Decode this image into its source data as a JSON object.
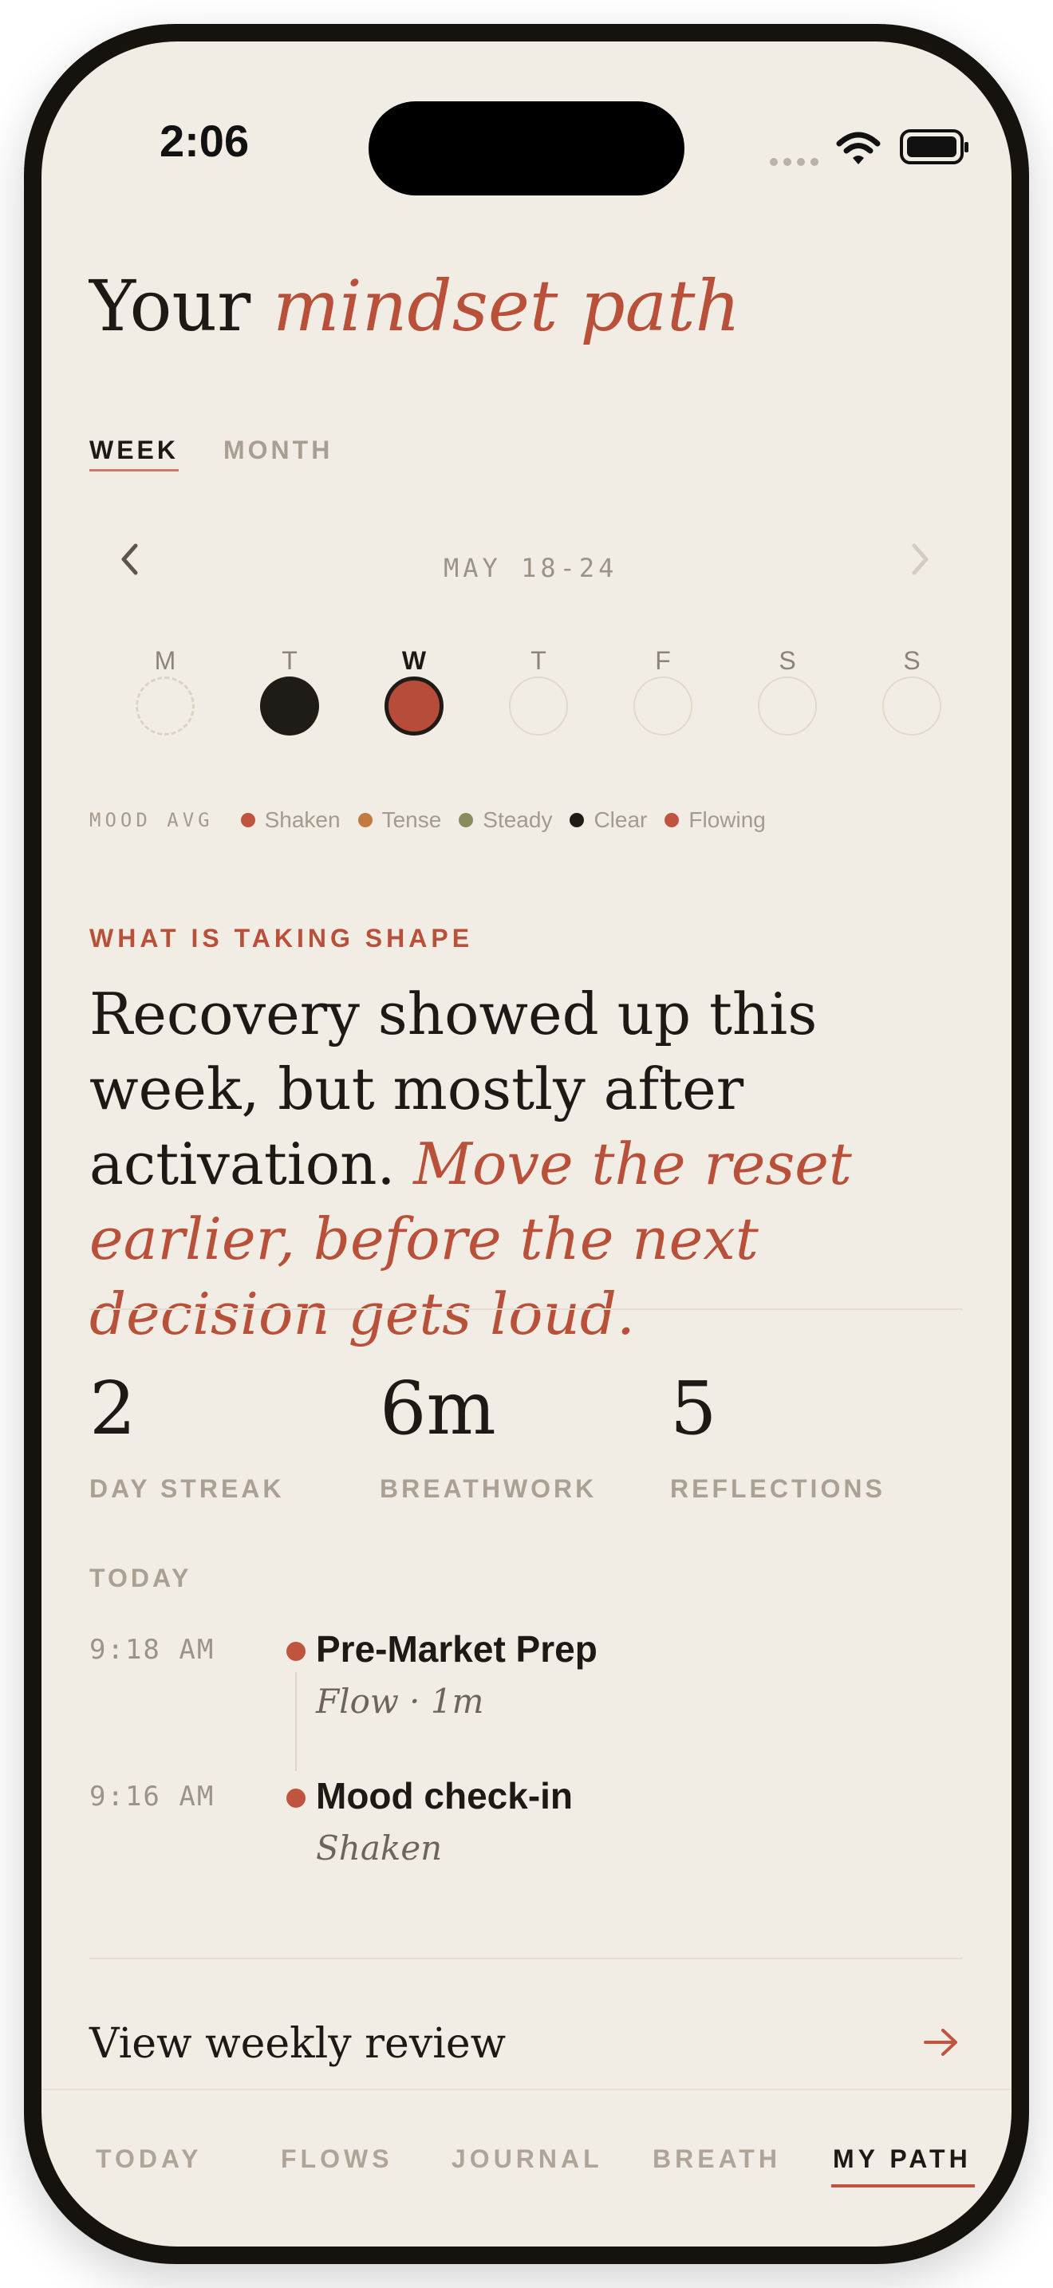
{
  "status_bar": {
    "time": "2:06"
  },
  "header": {
    "title_plain": "Your",
    "title_accent": "mindset path"
  },
  "tabs": [
    {
      "label": "WEEK",
      "active": true
    },
    {
      "label": "MONTH",
      "active": false
    }
  ],
  "week_nav": {
    "range": "MAY 18-24",
    "prev_icon": "chevron-left-icon",
    "next_icon": "chevron-right-icon"
  },
  "days": [
    {
      "label": "M",
      "state": "empty-dashed"
    },
    {
      "label": "T",
      "state": "clear"
    },
    {
      "label": "W",
      "state": "flowing-today"
    },
    {
      "label": "T",
      "state": "empty"
    },
    {
      "label": "F",
      "state": "empty"
    },
    {
      "label": "S",
      "state": "empty"
    },
    {
      "label": "S",
      "state": "empty"
    }
  ],
  "mood_legend": {
    "title": "MOOD AVG",
    "items": [
      {
        "label": "Shaken",
        "color": "#c0553f"
      },
      {
        "label": "Tense",
        "color": "#c27a3e"
      },
      {
        "label": "Steady",
        "color": "#8a8c5e"
      },
      {
        "label": "Clear",
        "color": "#1f1b17"
      },
      {
        "label": "Flowing",
        "color": "#c0553f"
      }
    ]
  },
  "insight": {
    "label": "WHAT IS TAKING SHAPE",
    "text_plain": "Recovery showed up this week, but mostly after activation.",
    "text_accent": "Move the reset earlier, before the next decision gets loud."
  },
  "stats": [
    {
      "value": "2",
      "label": "DAY STREAK"
    },
    {
      "value": "6m",
      "label": "BREATHWORK"
    },
    {
      "value": "5",
      "label": "REFLECTIONS"
    }
  ],
  "today": {
    "label": "TODAY",
    "entries": [
      {
        "time": "9:18 AM",
        "title": "Pre-Market Prep",
        "subtitle": "Flow · 1m"
      },
      {
        "time": "9:16 AM",
        "title": "Mood check-in",
        "subtitle": "Shaken"
      }
    ]
  },
  "review_link": {
    "label": "View weekly review",
    "icon": "arrow-right-icon"
  },
  "bottom_tabs": [
    {
      "label": "TODAY",
      "active": false
    },
    {
      "label": "FLOWS",
      "active": false
    },
    {
      "label": "JOURNAL",
      "active": false
    },
    {
      "label": "BREATH",
      "active": false
    },
    {
      "label": "MY PATH",
      "active": true
    }
  ],
  "colors": {
    "background": "#f2ede4",
    "accent": "#b8503a",
    "ink": "#1d1a16",
    "muted": "#a89e92"
  }
}
